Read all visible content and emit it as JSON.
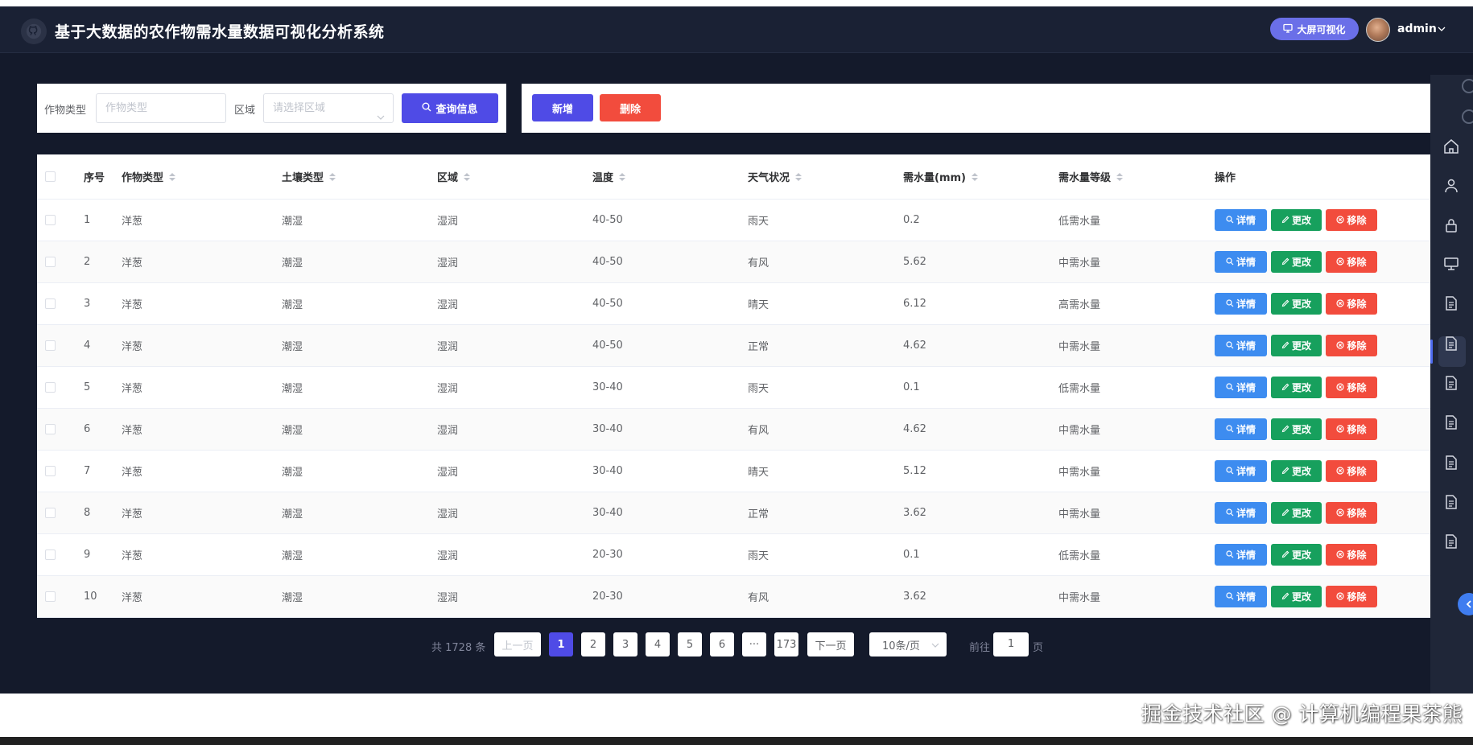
{
  "header": {
    "title": "基于大数据的农作物需水量数据可视化分析系统",
    "screen_button": "大屏可视化",
    "user": "admin"
  },
  "search": {
    "crop_label": "作物类型",
    "crop_placeholder": "作物类型",
    "region_label": "区域",
    "region_placeholder": "请选择区域",
    "query_button": "查询信息"
  },
  "actions": {
    "add_button": "新增",
    "delete_button": "删除"
  },
  "table": {
    "columns": [
      "序号",
      "作物类型",
      "土壤类型",
      "区域",
      "温度",
      "天气状况",
      "需水量(mm)",
      "需水量等级",
      "操作"
    ],
    "rows": [
      [
        "1",
        "洋葱",
        "潮湿",
        "湿润",
        "40-50",
        "雨天",
        "0.2",
        "低需水量"
      ],
      [
        "2",
        "洋葱",
        "潮湿",
        "湿润",
        "40-50",
        "有风",
        "5.62",
        "中需水量"
      ],
      [
        "3",
        "洋葱",
        "潮湿",
        "湿润",
        "40-50",
        "晴天",
        "6.12",
        "高需水量"
      ],
      [
        "4",
        "洋葱",
        "潮湿",
        "湿润",
        "40-50",
        "正常",
        "4.62",
        "中需水量"
      ],
      [
        "5",
        "洋葱",
        "潮湿",
        "湿润",
        "30-40",
        "雨天",
        "0.1",
        "低需水量"
      ],
      [
        "6",
        "洋葱",
        "潮湿",
        "湿润",
        "30-40",
        "有风",
        "4.62",
        "中需水量"
      ],
      [
        "7",
        "洋葱",
        "潮湿",
        "湿润",
        "30-40",
        "晴天",
        "5.12",
        "中需水量"
      ],
      [
        "8",
        "洋葱",
        "潮湿",
        "湿润",
        "30-40",
        "正常",
        "3.62",
        "中需水量"
      ],
      [
        "9",
        "洋葱",
        "潮湿",
        "湿润",
        "20-30",
        "雨天",
        "0.1",
        "低需水量"
      ],
      [
        "10",
        "洋葱",
        "潮湿",
        "湿润",
        "20-30",
        "有风",
        "3.62",
        "中需水量"
      ]
    ],
    "op_detail": "详情",
    "op_edit": "更改",
    "op_remove": "移除"
  },
  "pagination": {
    "total": "共 1728 条",
    "prev": "上一页",
    "pages": [
      "1",
      "2",
      "3",
      "4",
      "5",
      "6"
    ],
    "ellipsis": "···",
    "last_page": "173",
    "next": "下一页",
    "page_size": "10条/页",
    "goto_label": "前往",
    "goto_value": "1",
    "goto_unit": "页"
  },
  "watermark": "掘金技术社区 @ 计算机编程果茶熊",
  "icons": {
    "sidebar": [
      "home-icon",
      "user-icon",
      "lock-icon",
      "screen-icon",
      "document-icon",
      "document-icon",
      "document-icon",
      "document-icon",
      "document-icon",
      "document-icon",
      "document-icon"
    ]
  },
  "colors": {
    "primary": "#4f4be6",
    "danger": "#f24c3d",
    "success": "#17a05d",
    "info": "#3d8cf0",
    "background": "#141a2b"
  }
}
